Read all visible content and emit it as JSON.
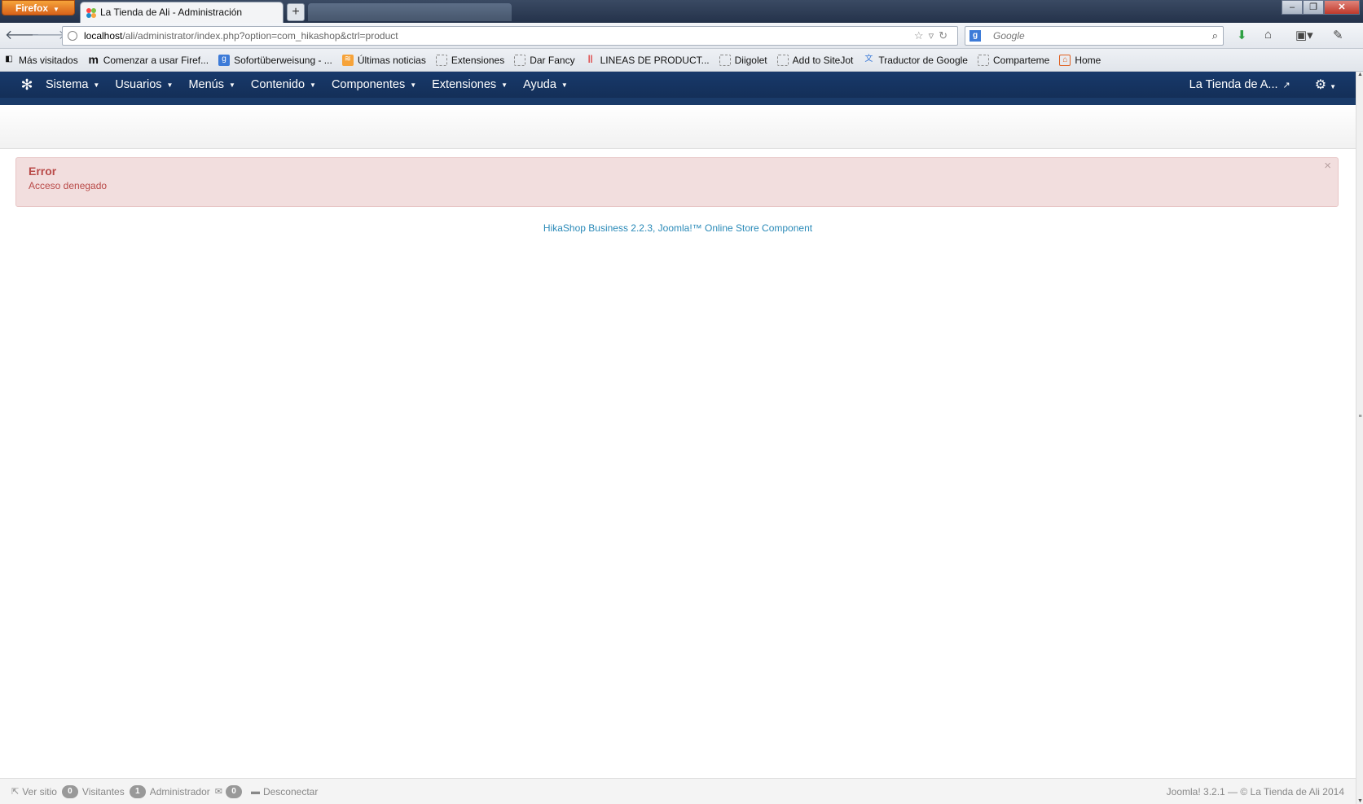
{
  "browser": {
    "firefox_label": "Firefox",
    "active_tab_title": "La Tienda de Ali - Administración",
    "url_host": "localhost",
    "url_path": "/ali/administrator/index.php?option=com_hikashop&ctrl=product",
    "search_placeholder": "Google",
    "bookmarks": [
      "Más visitados",
      "Comenzar a usar Firef...",
      "Sofortüberweisung - ...",
      "Últimas noticias",
      "Extensiones",
      "Dar Fancy",
      "LINEAS DE PRODUCT...",
      "Diigolet",
      "Add to SiteJot",
      "Traductor de Google",
      "Comparteme",
      "Home"
    ]
  },
  "joomla": {
    "menu": [
      "Sistema",
      "Usuarios",
      "Menús",
      "Contenido",
      "Componentes",
      "Extensiones",
      "Ayuda"
    ],
    "site_name": "La Tienda de A..."
  },
  "alert": {
    "title": "Error",
    "message": "Acceso denegado",
    "close": "×"
  },
  "footer_link": "HikaShop Business 2.2.3, Joomla!™ Online Store Component",
  "status": {
    "view_site": "Ver sitio",
    "visitors_count": "0",
    "visitors_label": "Visitantes",
    "admins_count": "1",
    "admins_label": "Administrador",
    "messages_count": "0",
    "logout": "Desconectar",
    "copyright": "Joomla! 3.2.1 — © La Tienda de Ali 2014"
  }
}
